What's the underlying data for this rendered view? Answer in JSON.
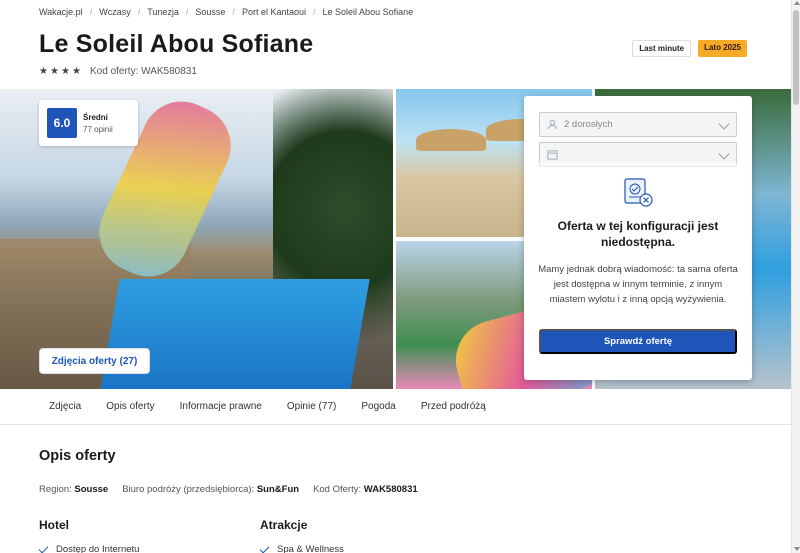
{
  "breadcrumb": [
    "Wakacje.pl",
    "Wczasy",
    "Tunezja",
    "Sousse",
    "Port el Kantaoui",
    "Le Soleil Abou Sofiane"
  ],
  "hotel": {
    "name": "Le Soleil Abou Sofiane",
    "stars": 4,
    "code_label": "Kod oferty: WAK580831"
  },
  "badges": {
    "last_minute": "Last minute",
    "season": "Lato 2025"
  },
  "rating": {
    "score": "6.0",
    "level": "Średni",
    "count": "77 opinii"
  },
  "gallery": {
    "photos_button": "Zdjęcia oferty (27)"
  },
  "booking": {
    "guests_value": "2 dorosłych",
    "date_value": "",
    "title": "Oferta w tej konfiguracji jest niedostępna.",
    "description": "Mamy jednak dobrą wiadomość: ta sama oferta jest dostępna w innym terminie, z innym miastem wylotu i z inną opcją wyżywienia.",
    "check_button": "Sprawdź ofertę",
    "icons": [
      "user-icon",
      "calendar-icon",
      "document-unavailable-icon"
    ]
  },
  "tabs": [
    "Zdjęcia",
    "Opis oferty",
    "Informacje prawne",
    "Opinie (77)",
    "Pogoda",
    "Przed podróżą"
  ],
  "description_section": {
    "title": "Opis oferty",
    "region_label": "Region:",
    "region_value": "Sousse",
    "operator_label": "Biuro podróży (przedsiębiorca):",
    "operator_value": "Sun&Fun",
    "code_label": "Kod Oferty:",
    "code_value": "WAK580831"
  },
  "features": {
    "hotel_title": "Hotel",
    "hotel_items": [
      "Dostęp do Internetu"
    ],
    "attractions_title": "Atrakcje",
    "attractions_items": [
      "Spa & Wellness"
    ]
  },
  "colors": {
    "primary": "#1f55b8",
    "badge_season": "#f7a928"
  }
}
